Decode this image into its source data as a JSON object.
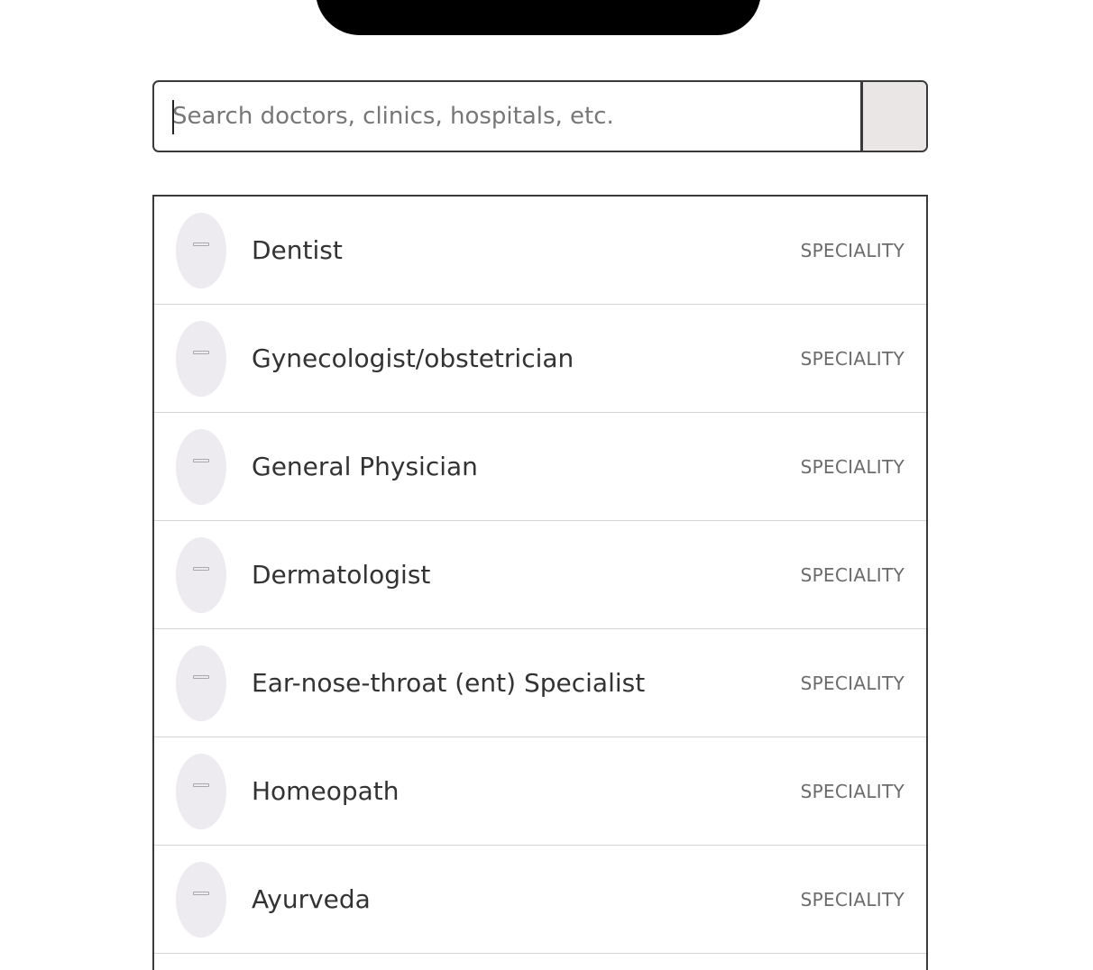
{
  "search": {
    "placeholder": "Search doctors, clinics, hospitals, etc.",
    "value": ""
  },
  "results": [
    {
      "label": "Dentist",
      "type": "SPECIALITY",
      "icon": "speciality-icon"
    },
    {
      "label": "Gynecologist/obstetrician",
      "type": "SPECIALITY",
      "icon": "speciality-icon"
    },
    {
      "label": "General Physician",
      "type": "SPECIALITY",
      "icon": "speciality-icon"
    },
    {
      "label": "Dermatologist",
      "type": "SPECIALITY",
      "icon": "speciality-icon"
    },
    {
      "label": "Ear-nose-throat (ent) Specialist",
      "type": "SPECIALITY",
      "icon": "speciality-icon"
    },
    {
      "label": "Homeopath",
      "type": "SPECIALITY",
      "icon": "speciality-icon"
    },
    {
      "label": "Ayurveda",
      "type": "SPECIALITY",
      "icon": "speciality-icon"
    }
  ],
  "colors": {
    "border": "#3a3a3a",
    "avatar_bg": "#edebf0",
    "button_bg": "#ebe6e6",
    "divider": "#d3d3d3"
  }
}
